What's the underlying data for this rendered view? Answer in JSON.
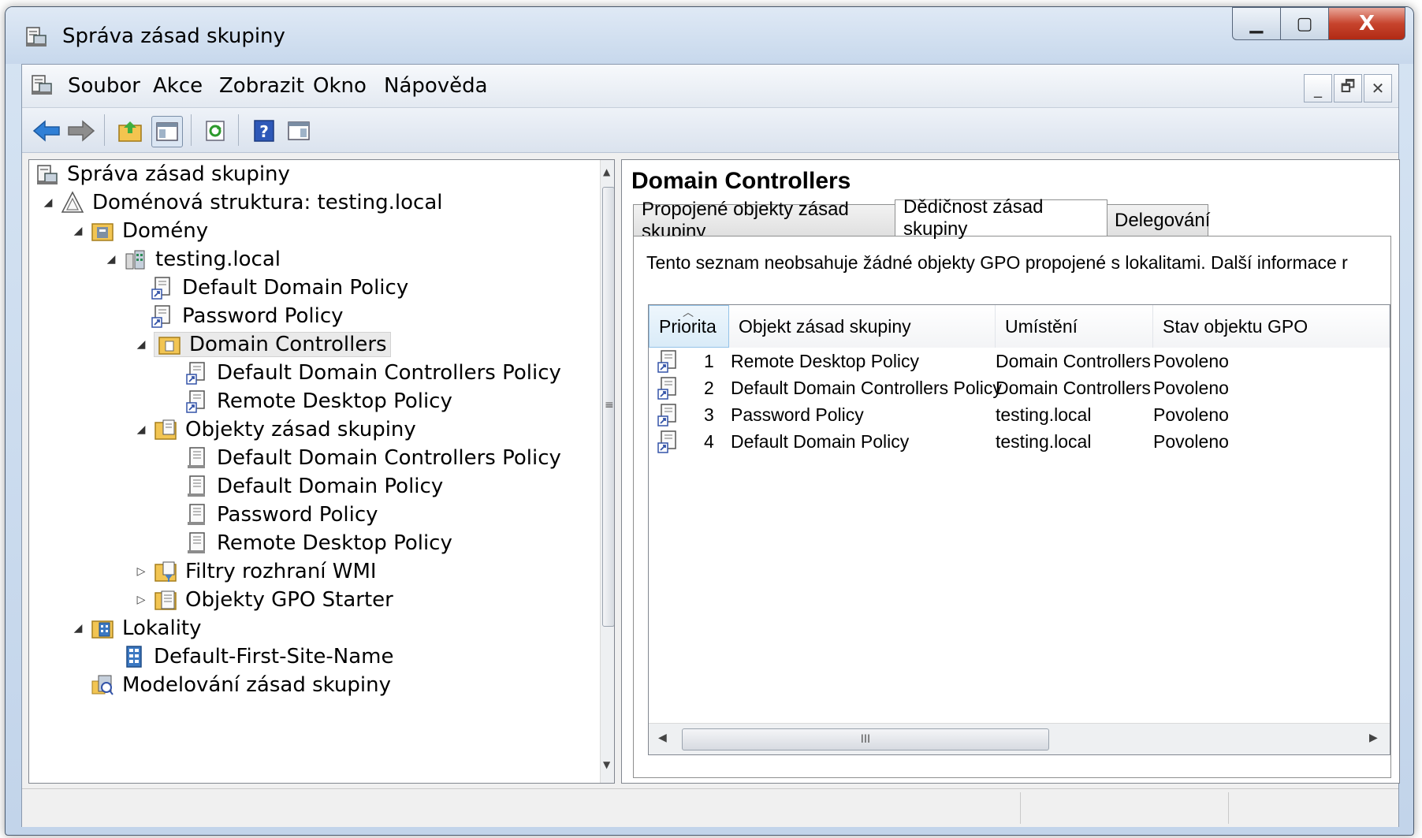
{
  "window": {
    "title": "Správa zásad skupiny",
    "minimize_glyph": "▁",
    "maximize_glyph": "▢",
    "close_glyph": "X"
  },
  "menubar": {
    "items": [
      "Soubor",
      "Akce",
      "Zobrazit",
      "Okno",
      "Nápověda"
    ],
    "mdi_minimize_glyph": "_",
    "mdi_restore_glyph": "🗗",
    "mdi_close_glyph": "✕"
  },
  "toolbar": {
    "icons": [
      "back-arrow-icon",
      "forward-arrow-icon",
      "up-folder-icon",
      "show-hide-console-tree-icon",
      "refresh-icon",
      "help-icon",
      "show-hide-action-pane-icon"
    ]
  },
  "tree": {
    "root": "Správa zásad skupiny",
    "forest": "Doménová struktura: testing.local",
    "domains": "Domény",
    "domain": "testing.local",
    "linked_gpo_1": "Default Domain Policy",
    "linked_gpo_2": "Password Policy",
    "ou": "Domain Controllers",
    "ou_gpo_1": "Default Domain Controllers Policy",
    "ou_gpo_2": "Remote Desktop Policy",
    "gpo_container": "Objekty zásad skupiny",
    "gpo_1": "Default Domain Controllers Policy",
    "gpo_2": "Default Domain Policy",
    "gpo_3": "Password Policy",
    "gpo_4": "Remote Desktop Policy",
    "wmi": "Filtry rozhraní WMI",
    "starter": "Objekty GPO Starter",
    "sites": "Lokality",
    "site": "Default-First-Site-Name",
    "modeling": "Modelování zásad skupiny"
  },
  "details": {
    "title": "Domain Controllers",
    "tabs": [
      "Propojené objekty zásad skupiny",
      "Dědičnost zásad skupiny",
      "Delegování"
    ],
    "active_tab": "Dědičnost zásad skupiny",
    "info": "Tento seznam neobsahuje žádné objekty GPO propojené s lokalitami. Další informace r",
    "columns": [
      "Priorita",
      "Objekt zásad skupiny",
      "Umístění",
      "Stav objektu GPO"
    ],
    "rows": [
      {
        "priority": "1",
        "gpo": "Remote Desktop Policy",
        "location": "Domain Controllers",
        "status": "Povoleno"
      },
      {
        "priority": "2",
        "gpo": "Default Domain Controllers Policy",
        "location": "Domain Controllers",
        "status": "Povoleno"
      },
      {
        "priority": "3",
        "gpo": "Password Policy",
        "location": "testing.local",
        "status": "Povoleno"
      },
      {
        "priority": "4",
        "gpo": "Default Domain Policy",
        "location": "testing.local",
        "status": "Povoleno"
      }
    ],
    "hscroll_grip": "III"
  }
}
